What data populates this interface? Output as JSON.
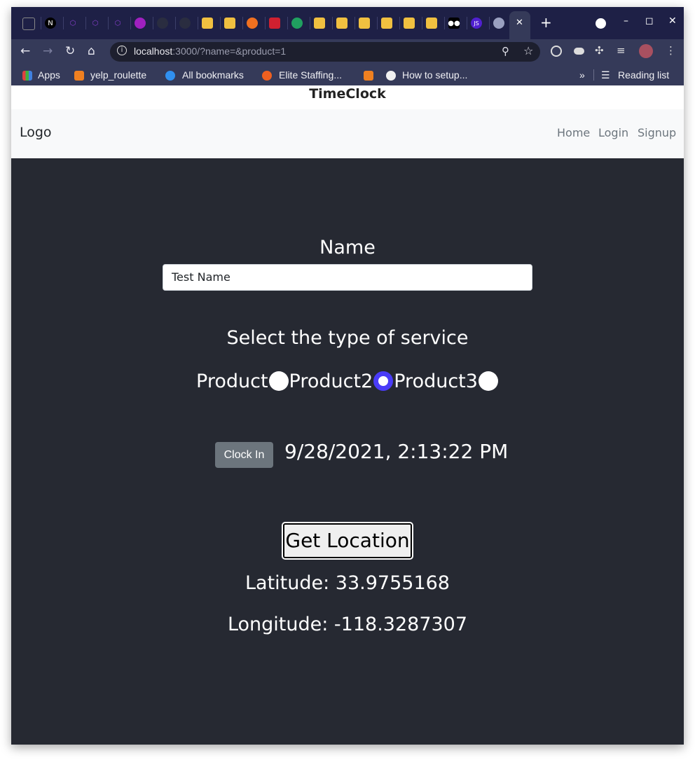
{
  "browser": {
    "address": {
      "host": "localhost",
      "rest": ":3000/?name=&product=1"
    },
    "active_tab_close": "✕",
    "new_tab": "+",
    "bookmarks": [
      {
        "label": "Apps"
      },
      {
        "label": "yelp_roulette"
      },
      {
        "label": "All bookmarks"
      },
      {
        "label": "Elite Staffing..."
      },
      {
        "label": "How to setup..."
      }
    ],
    "more_bookmarks": "»",
    "reading_list": "Reading list"
  },
  "page": {
    "site_title": "TimeClock",
    "nav": {
      "logo": "Logo",
      "links": [
        "Home",
        "Login",
        "Signup"
      ]
    },
    "name_label": "Name",
    "name_value": "Test Name",
    "service_label": "Select the type of service",
    "products": [
      {
        "label": "Product",
        "checked": false
      },
      {
        "label": "Product2",
        "checked": true
      },
      {
        "label": "Product3",
        "checked": false
      }
    ],
    "clock_in_label": "Clock In",
    "timestamp": "9/28/2021, 2:13:22 PM",
    "get_location_label": "Get Location",
    "latitude": "Latitude: 33.9755168",
    "longitude": "Longitude: -118.3287307"
  },
  "colors": {
    "radio_accent": "#4a3cf7",
    "page_bg": "#262932",
    "navbar_bg": "#f8f9fa"
  }
}
